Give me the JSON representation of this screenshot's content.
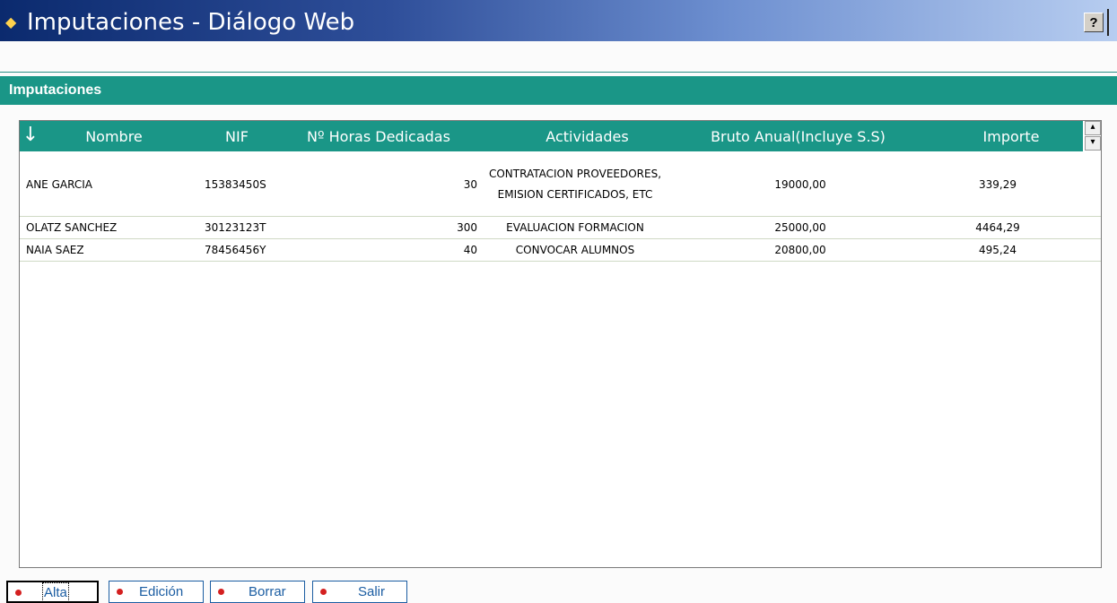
{
  "window": {
    "title": "Imputaciones - Diálogo Web",
    "help_label": "?"
  },
  "section": {
    "title": "Imputaciones"
  },
  "grid": {
    "sort_symbol": "↓",
    "columns": [
      "Nombre",
      "NIF",
      "Nº Horas Dedicadas",
      "Actividades",
      "Bruto Anual(Incluye S.S)",
      "Importe"
    ],
    "rows": [
      {
        "nombre": "ANE GARCIA",
        "nif": "15383450S",
        "horas": "30",
        "actividades": "CONTRATACION PROVEEDORES, EMISION CERTIFICADOS, ETC",
        "bruto": "19000,00",
        "importe": "339,29"
      },
      {
        "nombre": "OLATZ SANCHEZ",
        "nif": "30123123T",
        "horas": "300",
        "actividades": "EVALUACION FORMACION",
        "bruto": "25000,00",
        "importe": "4464,29"
      },
      {
        "nombre": "NAIA SAEZ",
        "nif": "78456456Y",
        "horas": "40",
        "actividades": "CONVOCAR ALUMNOS",
        "bruto": "20800,00",
        "importe": "495,24"
      }
    ]
  },
  "buttons": {
    "alta": "Alta",
    "edicion": "Edición",
    "borrar": "Borrar",
    "salir": "Salir"
  }
}
